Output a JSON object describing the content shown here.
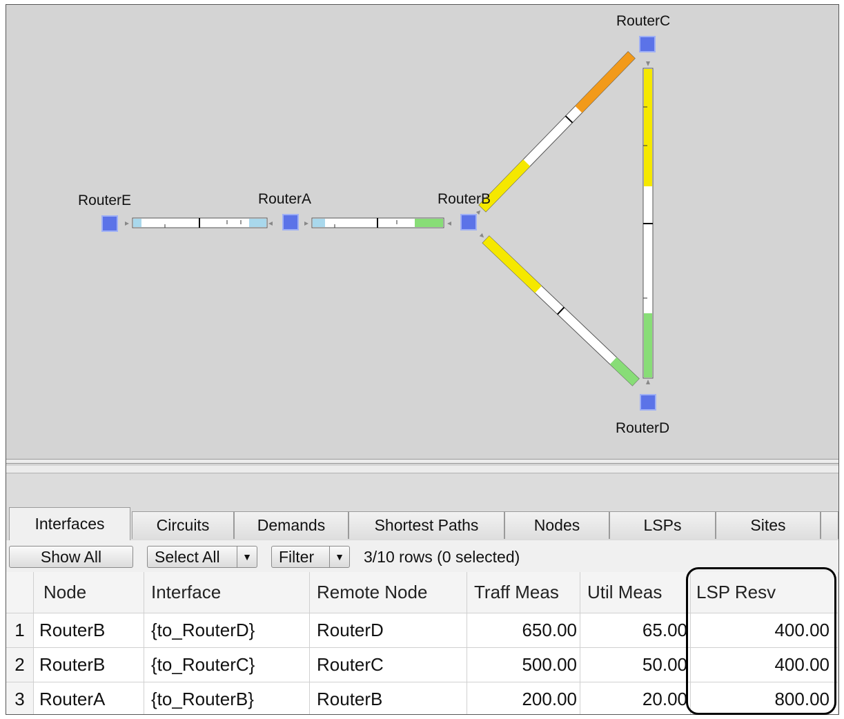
{
  "map": {
    "nodes": [
      {
        "name": "RouterE"
      },
      {
        "name": "RouterA"
      },
      {
        "name": "RouterB"
      },
      {
        "name": "RouterC"
      },
      {
        "name": "RouterD"
      }
    ],
    "node_color": "#5b73e8"
  },
  "tabs": [
    "Interfaces",
    "Circuits",
    "Demands",
    "Shortest Paths",
    "Nodes",
    "LSPs",
    "Sites"
  ],
  "active_tab": "Interfaces",
  "toolbar": {
    "show_all": "Show All",
    "select_all": "Select All",
    "filter": "Filter",
    "row_count": "3/10 rows (0 selected)"
  },
  "table": {
    "columns": [
      "",
      "Node",
      "Interface",
      "Remote Node",
      "Traff Meas",
      "Util Meas",
      "LSP Resv"
    ],
    "rows": [
      [
        "1",
        "RouterB",
        "{to_RouterD}",
        "RouterD",
        "650.00",
        "65.00",
        "400.00"
      ],
      [
        "2",
        "RouterB",
        "{to_RouterC}",
        "RouterC",
        "500.00",
        "50.00",
        "400.00"
      ],
      [
        "3",
        "RouterA",
        "{to_RouterB}",
        "RouterB",
        "200.00",
        "20.00",
        "800.00"
      ]
    ]
  },
  "colors": {
    "yellow": "#f5e800",
    "orange": "#f29a1a",
    "green": "#88dd77",
    "lightblue": "#a9d8ec"
  }
}
